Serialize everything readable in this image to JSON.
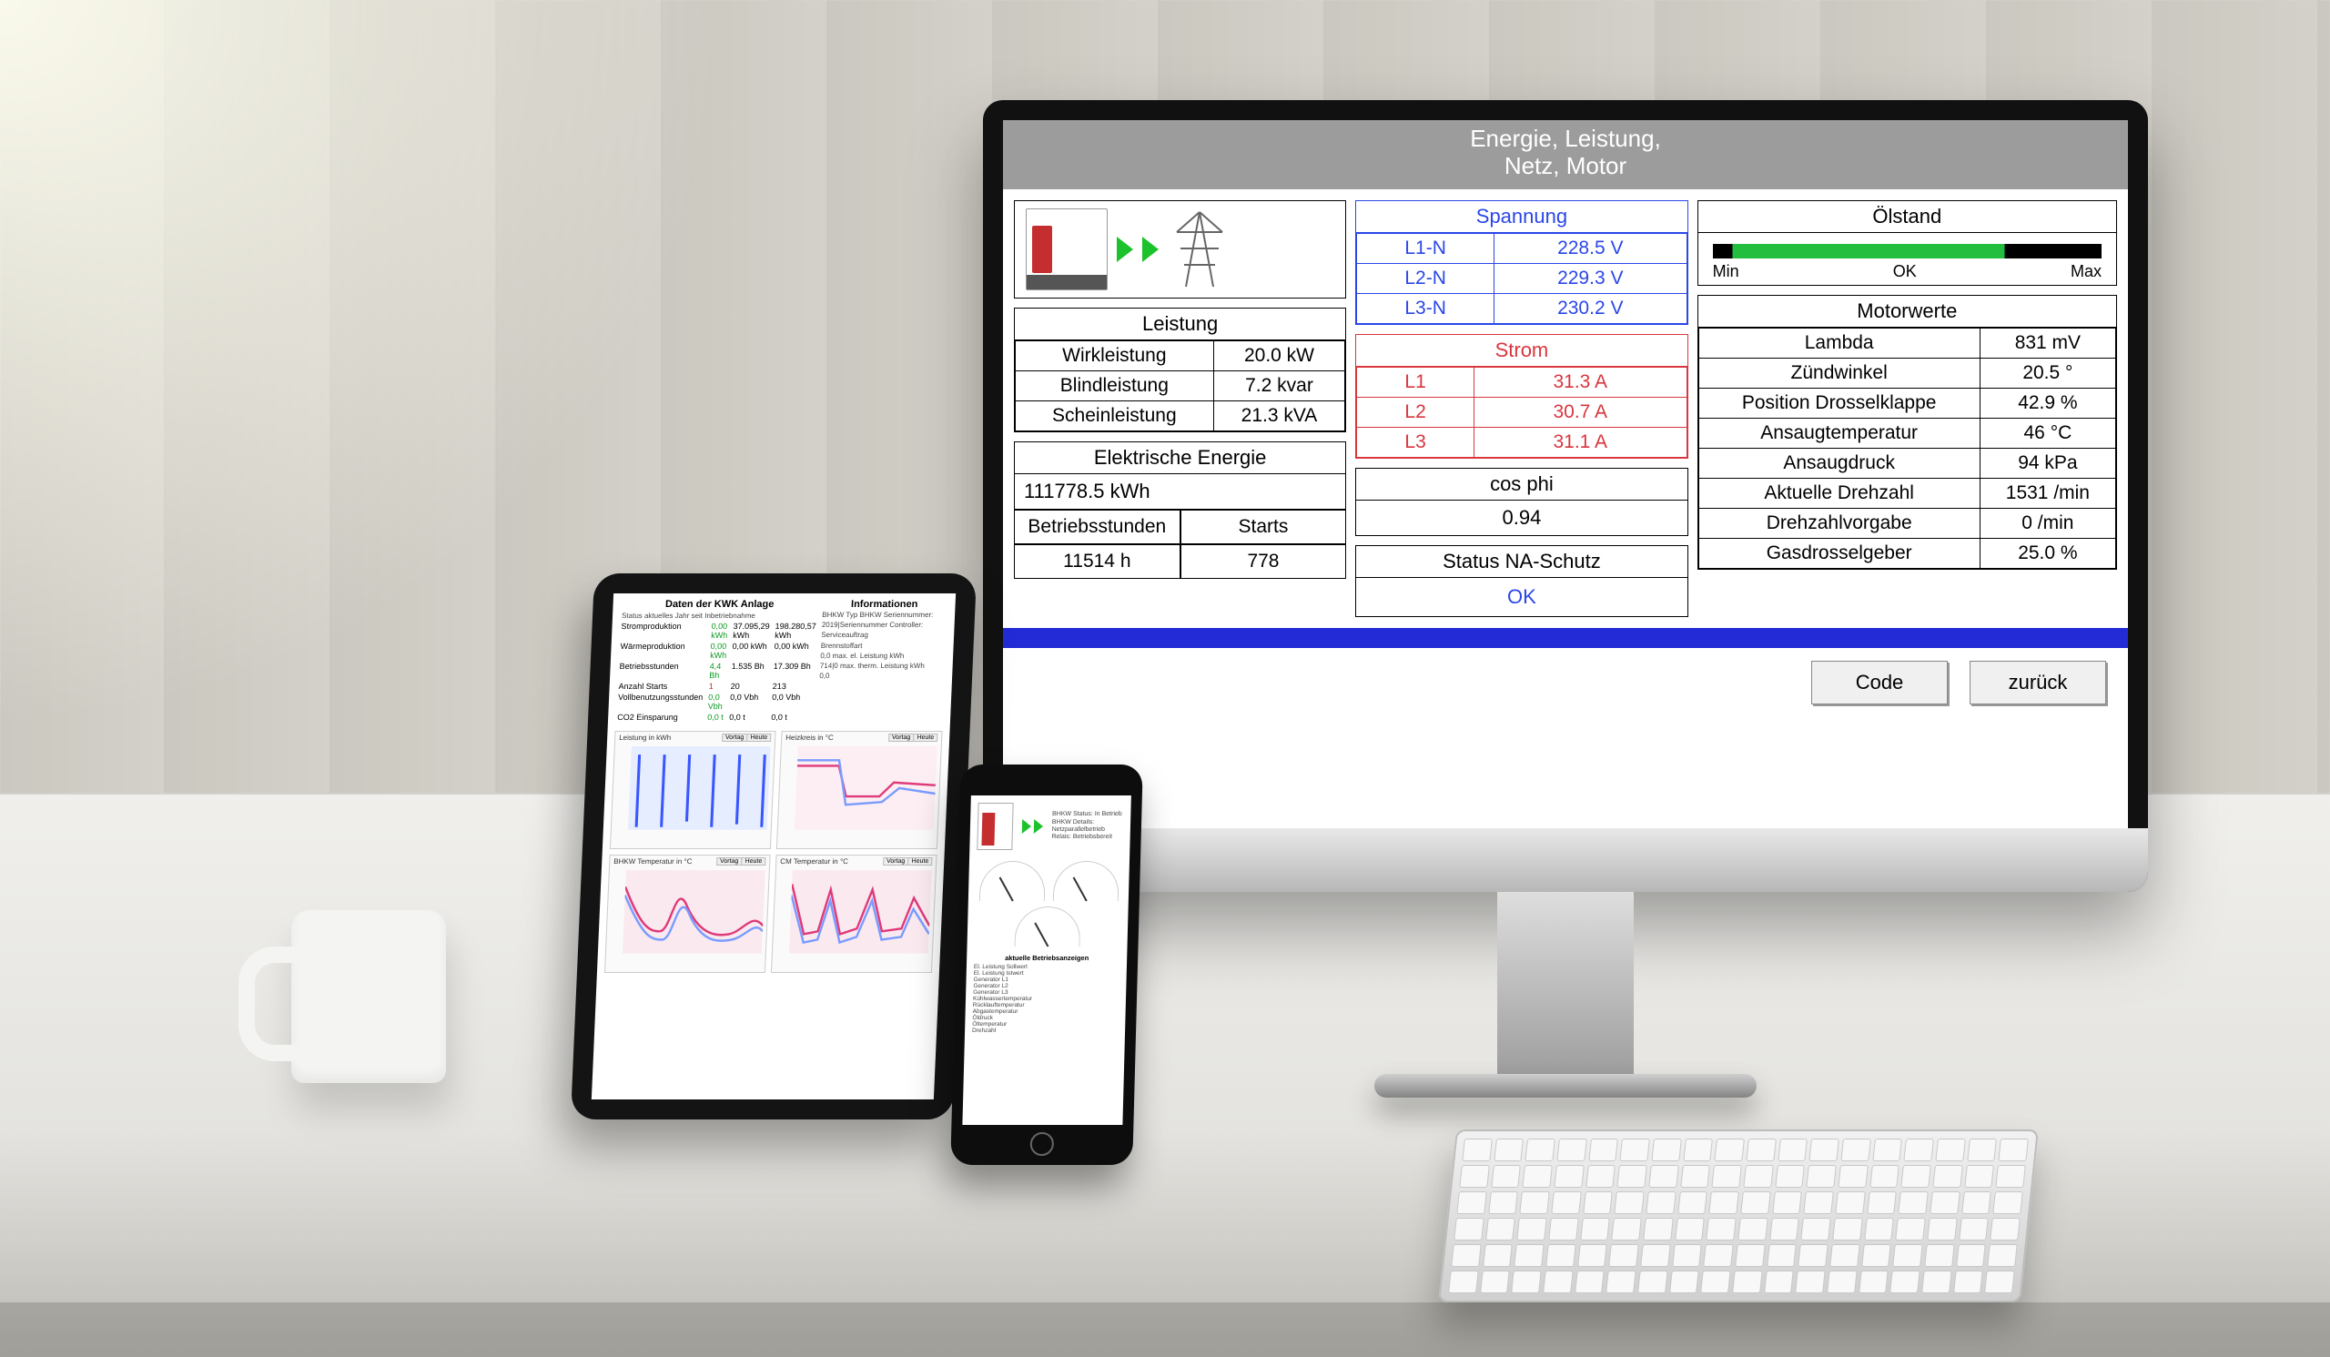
{
  "colors": {
    "accent_blue": "#232bd6",
    "alert_red": "#d9363e",
    "ok_green": "#1cc22c"
  },
  "monitor": {
    "header_line1": "Energie, Leistung,",
    "header_line2": "Netz, Motor",
    "spannung": {
      "title": "Spannung",
      "rows": [
        {
          "label": "L1-N",
          "value": "228.5 V"
        },
        {
          "label": "L2-N",
          "value": "229.3 V"
        },
        {
          "label": "L3-N",
          "value": "230.2 V"
        }
      ]
    },
    "leistung": {
      "title": "Leistung",
      "rows": [
        {
          "label": "Wirkleistung",
          "value": "20.0 kW"
        },
        {
          "label": "Blindleistung",
          "value": "7.2 kvar"
        },
        {
          "label": "Scheinleistung",
          "value": "21.3 kVA"
        }
      ]
    },
    "strom": {
      "title": "Strom",
      "rows": [
        {
          "label": "L1",
          "value": "31.3 A"
        },
        {
          "label": "L2",
          "value": "30.7 A"
        },
        {
          "label": "L3",
          "value": "31.1 A"
        }
      ]
    },
    "cosphi": {
      "title": "cos phi",
      "value": "0.94"
    },
    "status": {
      "title": "Status NA-Schutz",
      "value": "OK"
    },
    "el_energie_title": "Elektrische Energie",
    "el_energie_value": "111778.5 kWh",
    "betriebsstunden_title": "Betriebsstunden",
    "betriebsstunden_value": "11514 h",
    "starts_title": "Starts",
    "starts_value": "778",
    "oelstand": {
      "title": "Ölstand",
      "min": "Min",
      "ok": "OK",
      "max": "Max"
    },
    "motorwerte": {
      "title": "Motorwerte",
      "rows": [
        {
          "label": "Lambda",
          "value": "831 mV"
        },
        {
          "label": "Zündwinkel",
          "value": "20.5 °"
        },
        {
          "label": "Position Drosselklappe",
          "value": "42.9 %"
        },
        {
          "label": "Ansaugtemperatur",
          "value": "46 °C"
        },
        {
          "label": "Ansaugdruck",
          "value": "94 kPa"
        },
        {
          "label": "Aktuelle Drehzahl",
          "value": "1531 /min"
        },
        {
          "label": "Drehzahlvorgabe",
          "value": "0 /min"
        },
        {
          "label": "Gasdrosselgeber",
          "value": "25.0 %"
        }
      ]
    },
    "buttons": {
      "code": "Code",
      "back": "zurück"
    }
  },
  "tablet": {
    "left_title": "Daten der KWK Anlage",
    "right_title": "Informationen",
    "status_line": "Status   aktuelles Jahr   seit Inbetriebnahme",
    "left_rows": [
      {
        "label": "Stromproduktion",
        "a": "0,00 kWh",
        "b": "37.095,29 kWh",
        "c": "198.280,57 kWh"
      },
      {
        "label": "Wärmeproduktion",
        "a": "0,00 kWh",
        "b": "0,00 kWh",
        "c": "0,00 kWh"
      },
      {
        "label": "Betriebsstunden",
        "a": "4,4 Bh",
        "b": "1.535 Bh",
        "c": "17.309 Bh"
      },
      {
        "label": "Anzahl Starts",
        "a": "1",
        "b": "20",
        "c": "213"
      },
      {
        "label": "Vollbenutzungsstunden",
        "a": "0,0 Vbh",
        "b": "0,0 Vbh",
        "c": "0,0 Vbh"
      },
      {
        "label": "CO2 Einsparung",
        "a": "0,0 t",
        "b": "0,0 t",
        "c": "0,0 t"
      }
    ],
    "right_rows": [
      "BHKW Typ    BHKW Seriennummer:",
      "2019|Seriennummer Controller:",
      "Serviceauftrag",
      "     Brennstoffart",
      "0,0   max. el. Leistung kWh",
      "714|0 max. therm. Leistung kWh",
      "0,0"
    ],
    "charts": [
      {
        "title": "Leistung in kWh",
        "btns": [
          "Vortag",
          "Heute"
        ]
      },
      {
        "title": "Heizkreis in °C",
        "btns": [
          "Vortag",
          "Heute"
        ]
      },
      {
        "title": "BHKW Temperatur in °C",
        "btns": [
          "Vortag",
          "Heute"
        ]
      },
      {
        "title": "CM Temperatur in °C",
        "btns": [
          "Vortag",
          "Heute"
        ]
      }
    ]
  },
  "phone": {
    "info_lines": [
      "BHKW Status: In Betrieb",
      "BHKW Details: Netzparallelbetrieb",
      "Relais: Betriebsbereit"
    ],
    "list_title": "aktuelle Betriebsanzeigen",
    "list_items": [
      "El. Leistung Sollwert",
      "El. Leistung Istwert",
      "Generator L1",
      "Generator L2",
      "Generator L3",
      "Kühlwassertemperatur",
      "Rücklauftemperatur",
      "Abgastemperatur",
      "Öldruck",
      "Öltemperatur",
      "Drehzahl"
    ]
  }
}
